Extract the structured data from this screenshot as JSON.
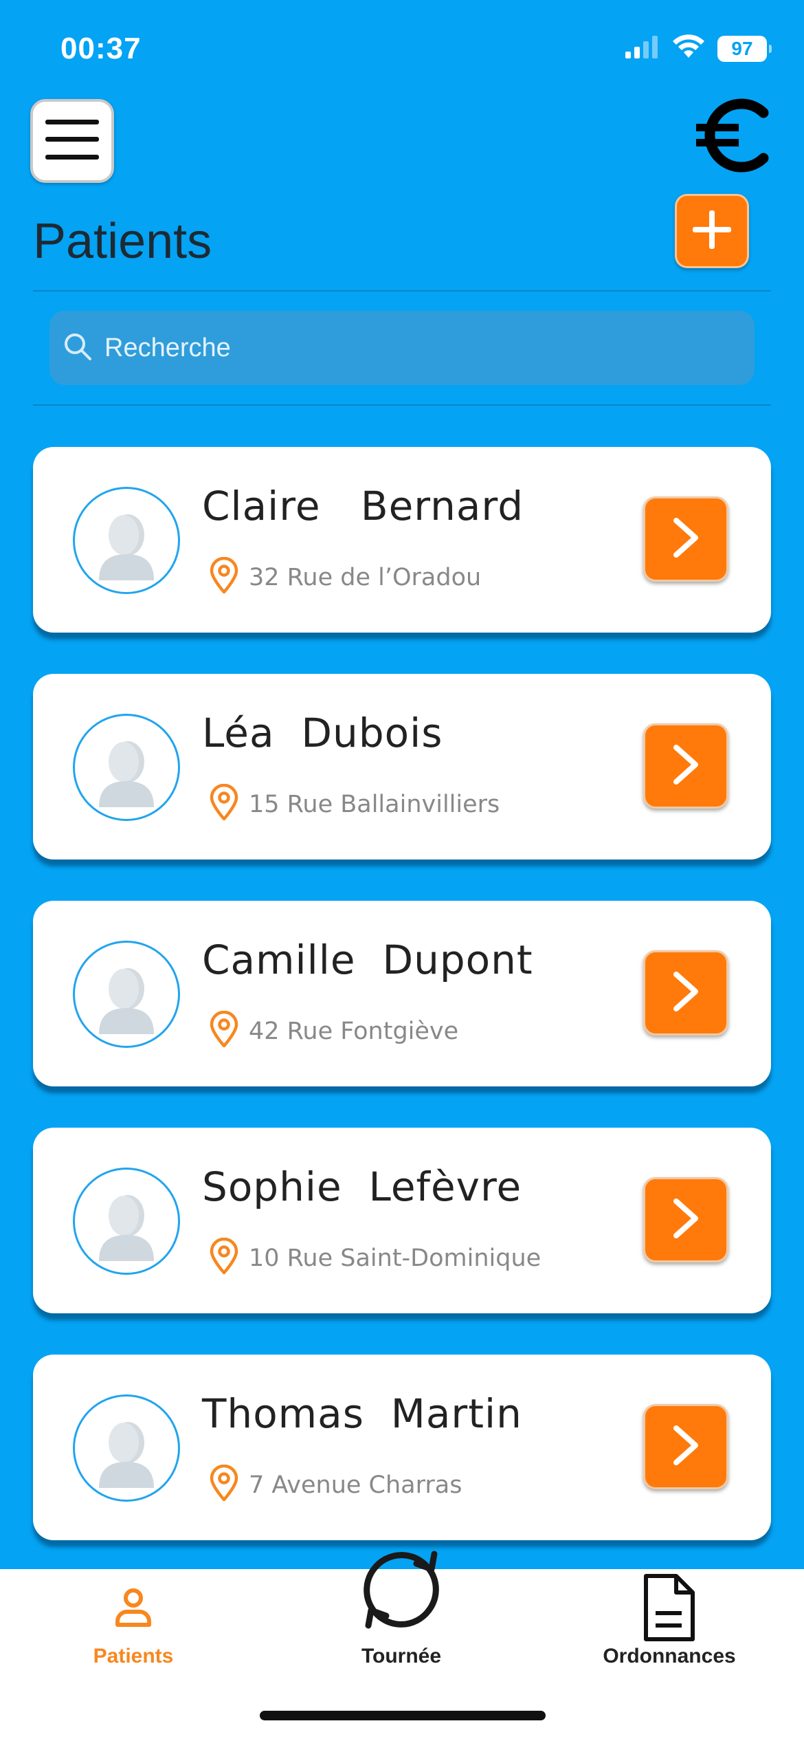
{
  "status_bar": {
    "time": "00:37",
    "battery": "97"
  },
  "header": {
    "title": "Patients"
  },
  "search": {
    "placeholder": "Recherche"
  },
  "patients": [
    {
      "name": "Claire   Bernard",
      "address": "32 Rue de l’Oradou"
    },
    {
      "name": "Léa  Dubois",
      "address": "15 Rue Ballainvilliers"
    },
    {
      "name": "Camille  Dupont",
      "address": "42 Rue Fontgiève"
    },
    {
      "name": "Sophie  Lefèvre",
      "address": "10 Rue Saint-Dominique"
    },
    {
      "name": "Thomas  Martin",
      "address": "7 Avenue Charras"
    }
  ],
  "tabs": [
    {
      "label": "Patients",
      "icon": "person-icon",
      "active": true
    },
    {
      "label": "Tournée",
      "icon": "refresh-icon",
      "active": false
    },
    {
      "label": "Ordonnances",
      "icon": "document-icon",
      "active": false
    }
  ],
  "colors": {
    "background": "#04a3f4",
    "accent": "#ff7a0a",
    "card": "#ffffff",
    "active_tab": "#f7871f",
    "inactive_tab": "#222222"
  }
}
